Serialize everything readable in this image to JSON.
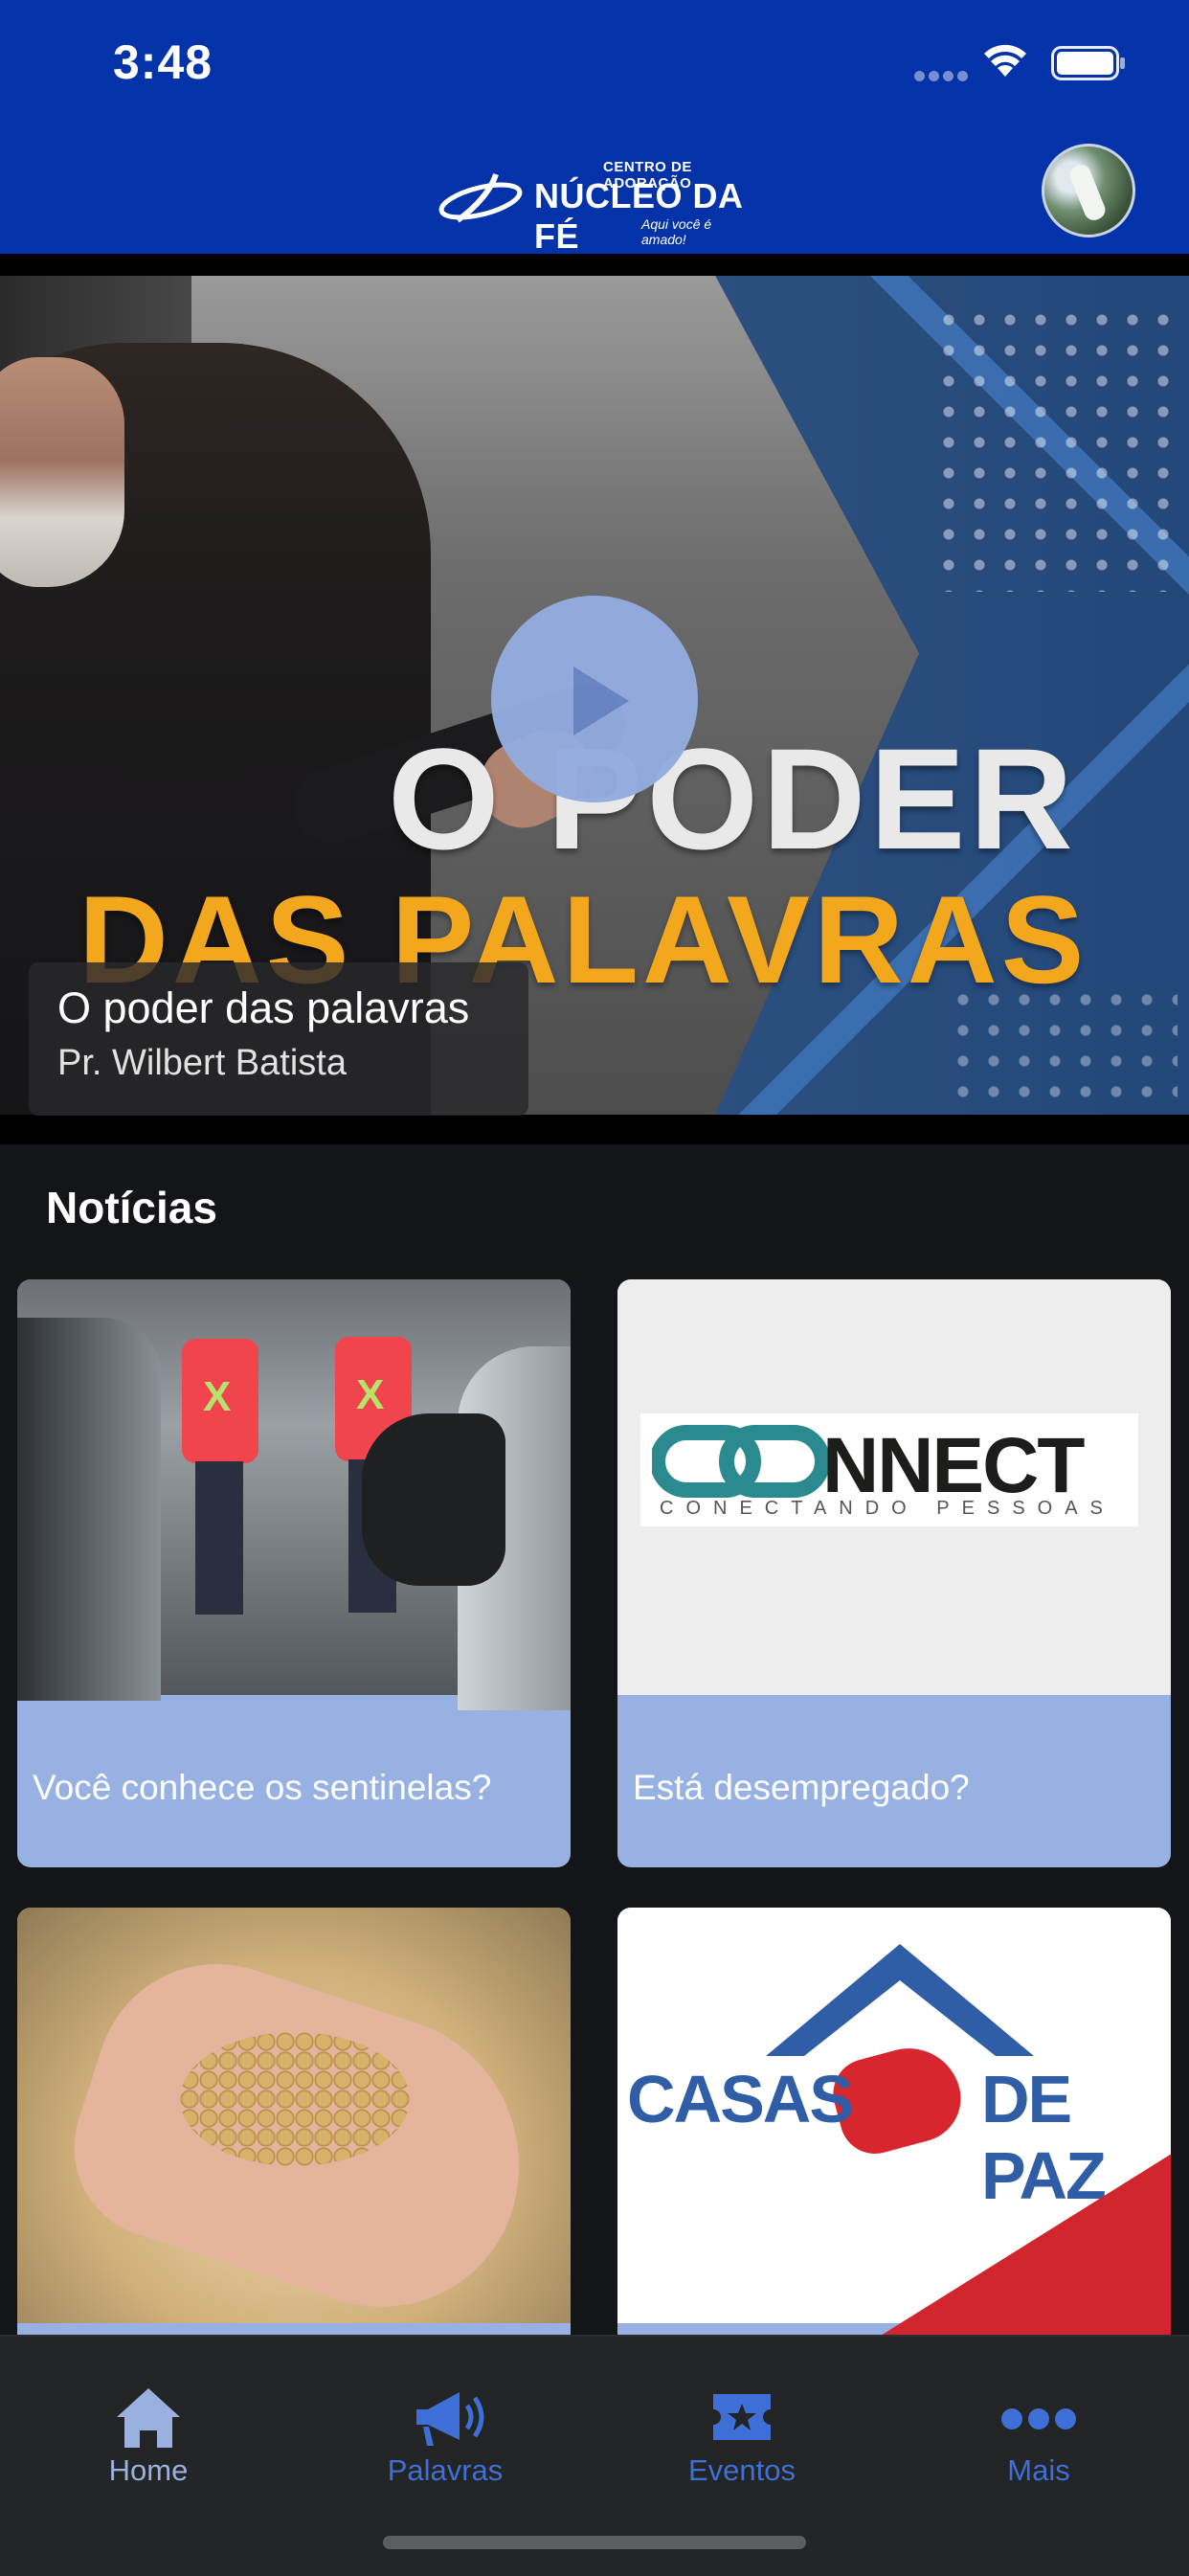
{
  "status_bar": {
    "time": "3:48"
  },
  "header": {
    "logo_top": "CENTRO DE ADORAÇÃO",
    "logo_main": "NÚCLEO DA FÉ",
    "logo_sub": "Aqui você é amado!"
  },
  "hero": {
    "video_title": "O poder das palavras",
    "video_author": "Pr. Wilbert Batista",
    "thumbnail_line1": "O PODER",
    "thumbnail_line2": "DAS PALAVRAS"
  },
  "news": {
    "section_title": "Notícias",
    "items": [
      {
        "label": "Você conhece os sentinelas?",
        "image": "security-staff-photo"
      },
      {
        "label": "Está desempregado?",
        "image": "connect-logo",
        "logo_text": "NNECT",
        "logo_sub": "CONECTANDO PESSOAS"
      },
      {
        "label": "",
        "image": "hand-with-seeds-photo"
      },
      {
        "label": "",
        "image": "casas-de-paz-logo",
        "logo_left": "CASAS",
        "logo_right": "DE PAZ"
      }
    ]
  },
  "tab_bar": {
    "tabs": [
      {
        "label": "Home",
        "icon": "home-icon",
        "active": true
      },
      {
        "label": "Palavras",
        "icon": "megaphone-icon",
        "active": false
      },
      {
        "label": "Eventos",
        "icon": "ticket-star-icon",
        "active": false
      },
      {
        "label": "Mais",
        "icon": "more-dots-icon",
        "active": false
      }
    ]
  },
  "colors": {
    "header_blue": "#0433a9",
    "card_blue": "#98b1e3",
    "tab_active": "#9ab0df",
    "tab_inactive": "#3d6fd6",
    "background": "#141518"
  }
}
